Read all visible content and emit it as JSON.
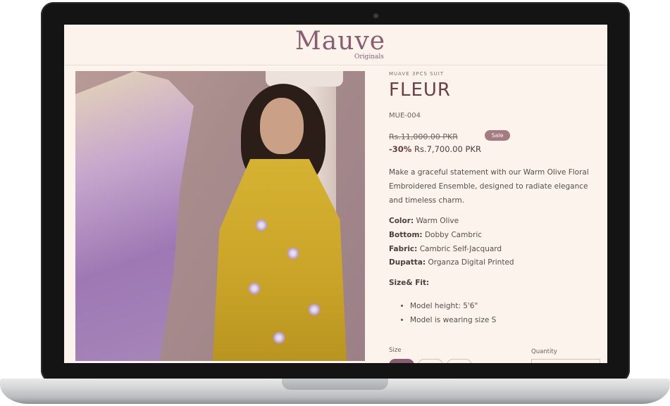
{
  "brand": {
    "logo_text": "Mauve",
    "logo_sub": "Originals"
  },
  "product": {
    "eyebrow": "MUAVE 3PCS SUIT",
    "title": "FLEUR",
    "sku": "MUE-004",
    "price_original": "Rs.11,000.00 PKR",
    "sale_badge": "Sale",
    "discount": "-30%",
    "price_current": "Rs.7,700.00 PKR",
    "description": "Make a graceful statement with our Warm Olive Floral Embroidered Ensemble, designed to radiate elegance and timeless charm.",
    "specs": [
      {
        "label": "Color:",
        "value": "Warm Olive"
      },
      {
        "label": "Bottom:",
        "value": "Dobby Cambric"
      },
      {
        "label": "Fabric:",
        "value": "Cambric Self-Jacquard"
      },
      {
        "label": "Dupatta:",
        "value": "Organza Digital Printed"
      }
    ],
    "fit_heading": "Size& Fit:",
    "fit_items": [
      "Model height: 5'6\"",
      "Model is wearing size S"
    ],
    "size_label": "Size",
    "quantity_label": "Quantity"
  },
  "colors": {
    "brand": "#8a5d70",
    "background": "#fbf3ec",
    "title": "#6c3f42"
  }
}
